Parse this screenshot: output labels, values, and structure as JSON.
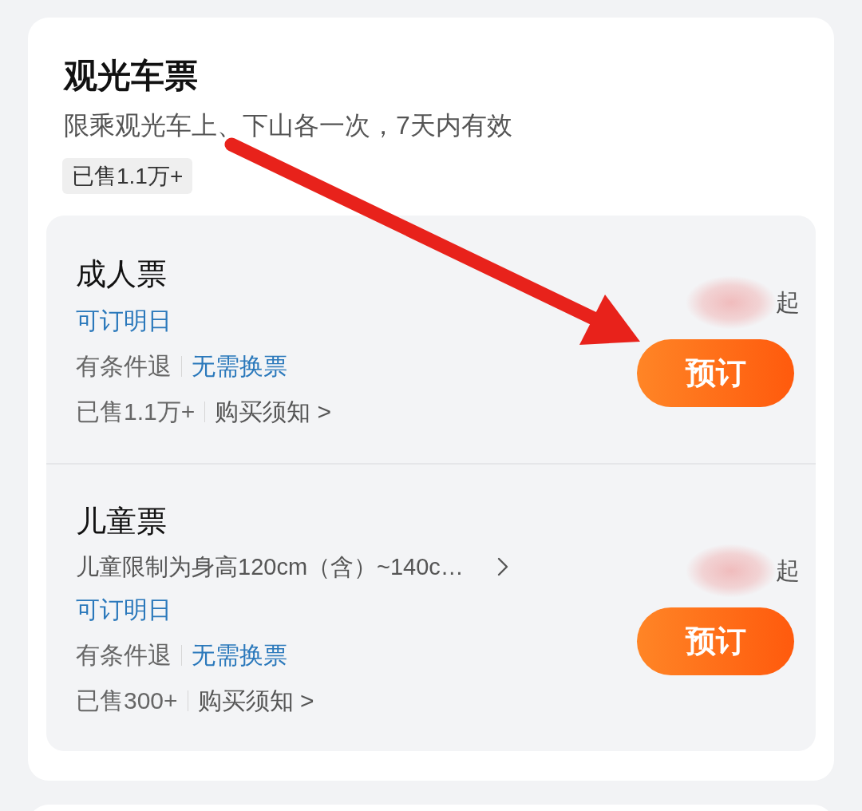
{
  "section": {
    "title": "观光车票",
    "subtitle": "限乘观光车上、下山各一次，7天内有效",
    "sold_badge": "已售1.1万+"
  },
  "tickets": [
    {
      "name": "成人票",
      "availability": "可订明日",
      "tags": [
        {
          "text": "有条件退",
          "kind": "plain"
        },
        {
          "text": "无需换票",
          "kind": "highlight"
        }
      ],
      "sold": "已售1.1万+",
      "notice_link": "购买须知 >",
      "price_blurred": true,
      "price_suffix": "起",
      "button": "预订"
    },
    {
      "name": "儿童票",
      "description": "儿童限制为身高120cm（含）~140c…",
      "availability": "可订明日",
      "tags": [
        {
          "text": "有条件退",
          "kind": "plain"
        },
        {
          "text": "无需换票",
          "kind": "highlight"
        }
      ],
      "sold": "已售300+",
      "notice_link": "购买须知 >",
      "price_blurred": true,
      "price_suffix": "起",
      "button": "预订"
    }
  ],
  "annotations": [
    {
      "kind": "arrow"
    }
  ]
}
